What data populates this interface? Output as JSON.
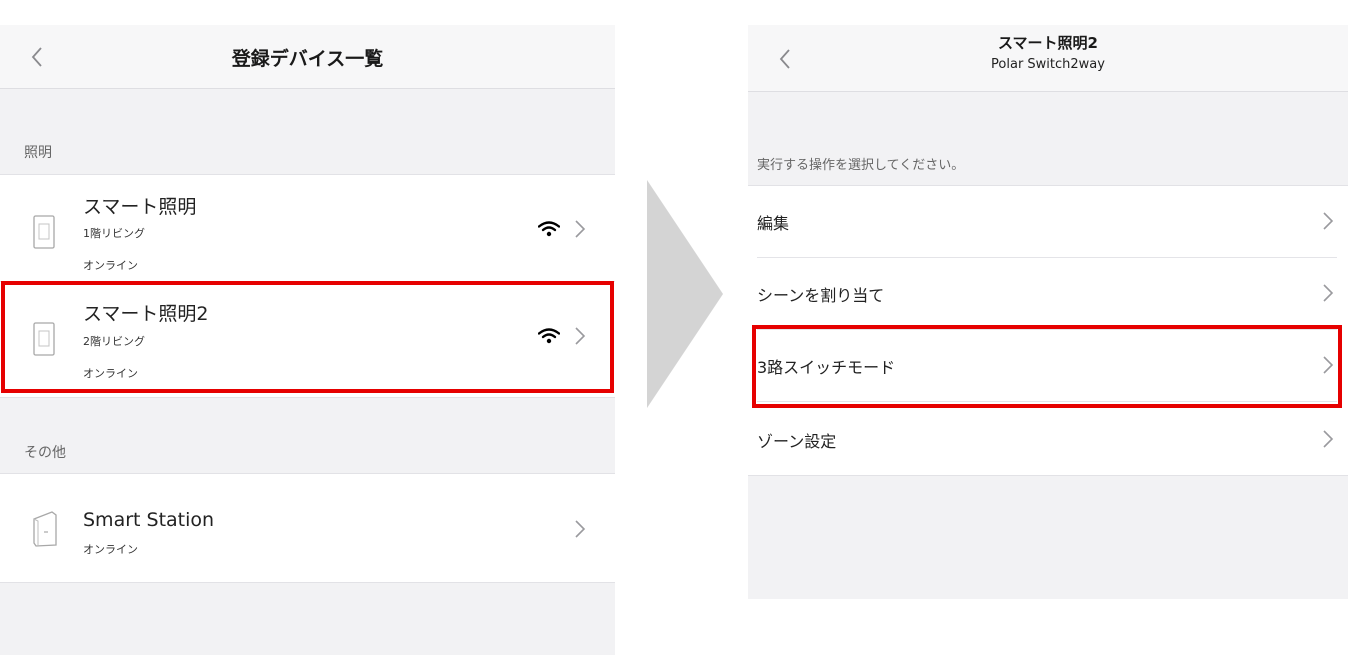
{
  "left_screen": {
    "title": "登録デバイス一覧",
    "sections": [
      {
        "header": "照明",
        "devices": [
          {
            "name": "スマート照明",
            "room": "1階リビング",
            "status": "オンライン",
            "wifi": true
          },
          {
            "name": "スマート照明2",
            "room": "2階リビング",
            "status": "オンライン",
            "wifi": true
          }
        ]
      },
      {
        "header": "その他",
        "devices": [
          {
            "name": "Smart Station",
            "status": "オンライン",
            "wifi": false
          }
        ]
      }
    ]
  },
  "right_screen": {
    "title": "スマート照明2",
    "subtitle": "Polar Switch2way",
    "section_header": "実行する操作を選択してください。",
    "menu_items": [
      {
        "label": "編集"
      },
      {
        "label": "シーンを割り当て"
      },
      {
        "label": "3路スイッチモード"
      },
      {
        "label": "ゾーン設定"
      }
    ]
  },
  "colors": {
    "highlight": "#e60000",
    "arrow": "#d4d4d4",
    "screen_background": "#f2f2f4"
  }
}
